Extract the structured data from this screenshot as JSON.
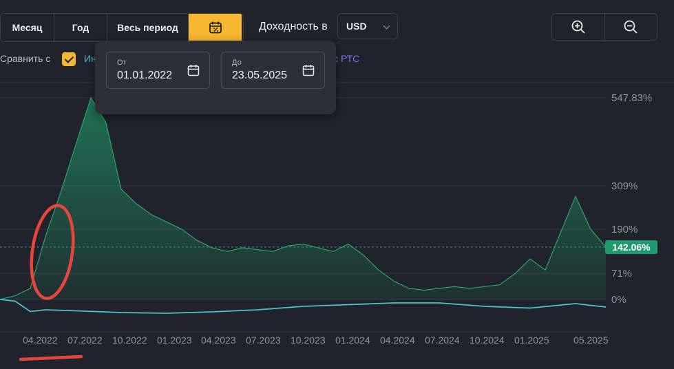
{
  "toolbar": {
    "periods": [
      {
        "label": "Месяц",
        "active": false
      },
      {
        "label": "Год",
        "active": false
      },
      {
        "label": "Весь период",
        "active": false
      }
    ],
    "calendar_icon": "calendar-percent-icon",
    "yield_label": "Доходность в",
    "currency": "USD",
    "zoom_in_icon": "zoom-in-icon",
    "zoom_out_icon": "zoom-out-icon"
  },
  "compare": {
    "label": "Сравнить с",
    "checked": true,
    "legend_left": "Ин",
    "legend_right": "с РТС"
  },
  "date_range": {
    "from_label": "От",
    "from_value": "01.01.2022",
    "to_label": "До",
    "to_value": "23.05.2025"
  },
  "chart_data": {
    "type": "area",
    "y_ticks": [
      "547.83%",
      "309%",
      "190%",
      "71%",
      "0%"
    ],
    "x_ticks": [
      "04.2022",
      "07.2022",
      "10.2022",
      "01.2023",
      "04.2023",
      "07.2023",
      "10.2023",
      "01.2024",
      "04.2024",
      "07.2024",
      "10.2024",
      "01.2025",
      "05.2025"
    ],
    "current_value_label": "142.06%",
    "grid": true,
    "series": [
      {
        "color": "#2fa074",
        "x": [
          "2022-01",
          "2022-02",
          "2022-03",
          "2022-04",
          "2022-05",
          "2022-06",
          "2022-07",
          "2022-08",
          "2022-09",
          "2022-10",
          "2022-11",
          "2022-12",
          "2023-01",
          "2023-02",
          "2023-03",
          "2023-04",
          "2023-05",
          "2023-06",
          "2023-07",
          "2023-08",
          "2023-09",
          "2023-10",
          "2023-11",
          "2023-12",
          "2024-01",
          "2024-02",
          "2024-03",
          "2024-04",
          "2024-05",
          "2024-06",
          "2024-07",
          "2024-08",
          "2024-09",
          "2024-10",
          "2024-11",
          "2024-12",
          "2025-01",
          "2025-02",
          "2025-03",
          "2025-04",
          "2025-05"
        ],
        "values": [
          0,
          10,
          30,
          170,
          290,
          420,
          548,
          480,
          300,
          260,
          230,
          210,
          190,
          160,
          140,
          130,
          140,
          135,
          130,
          145,
          150,
          140,
          130,
          150,
          120,
          80,
          50,
          30,
          25,
          30,
          35,
          30,
          35,
          40,
          70,
          110,
          80,
          180,
          280,
          190,
          142
        ]
      },
      {
        "color": "#4fc1c9",
        "x": [
          "2022-01",
          "2022-02",
          "2022-03",
          "2022-04",
          "2022-06",
          "2022-09",
          "2022-12",
          "2023-03",
          "2023-06",
          "2023-09",
          "2023-12",
          "2024-03",
          "2024-06",
          "2024-09",
          "2024-12",
          "2025-03",
          "2025-05"
        ],
        "values": [
          0,
          -5,
          -35,
          -30,
          -33,
          -38,
          -40,
          -36,
          -30,
          -20,
          -15,
          -10,
          -10,
          -20,
          -25,
          -12,
          -22
        ]
      }
    ]
  }
}
